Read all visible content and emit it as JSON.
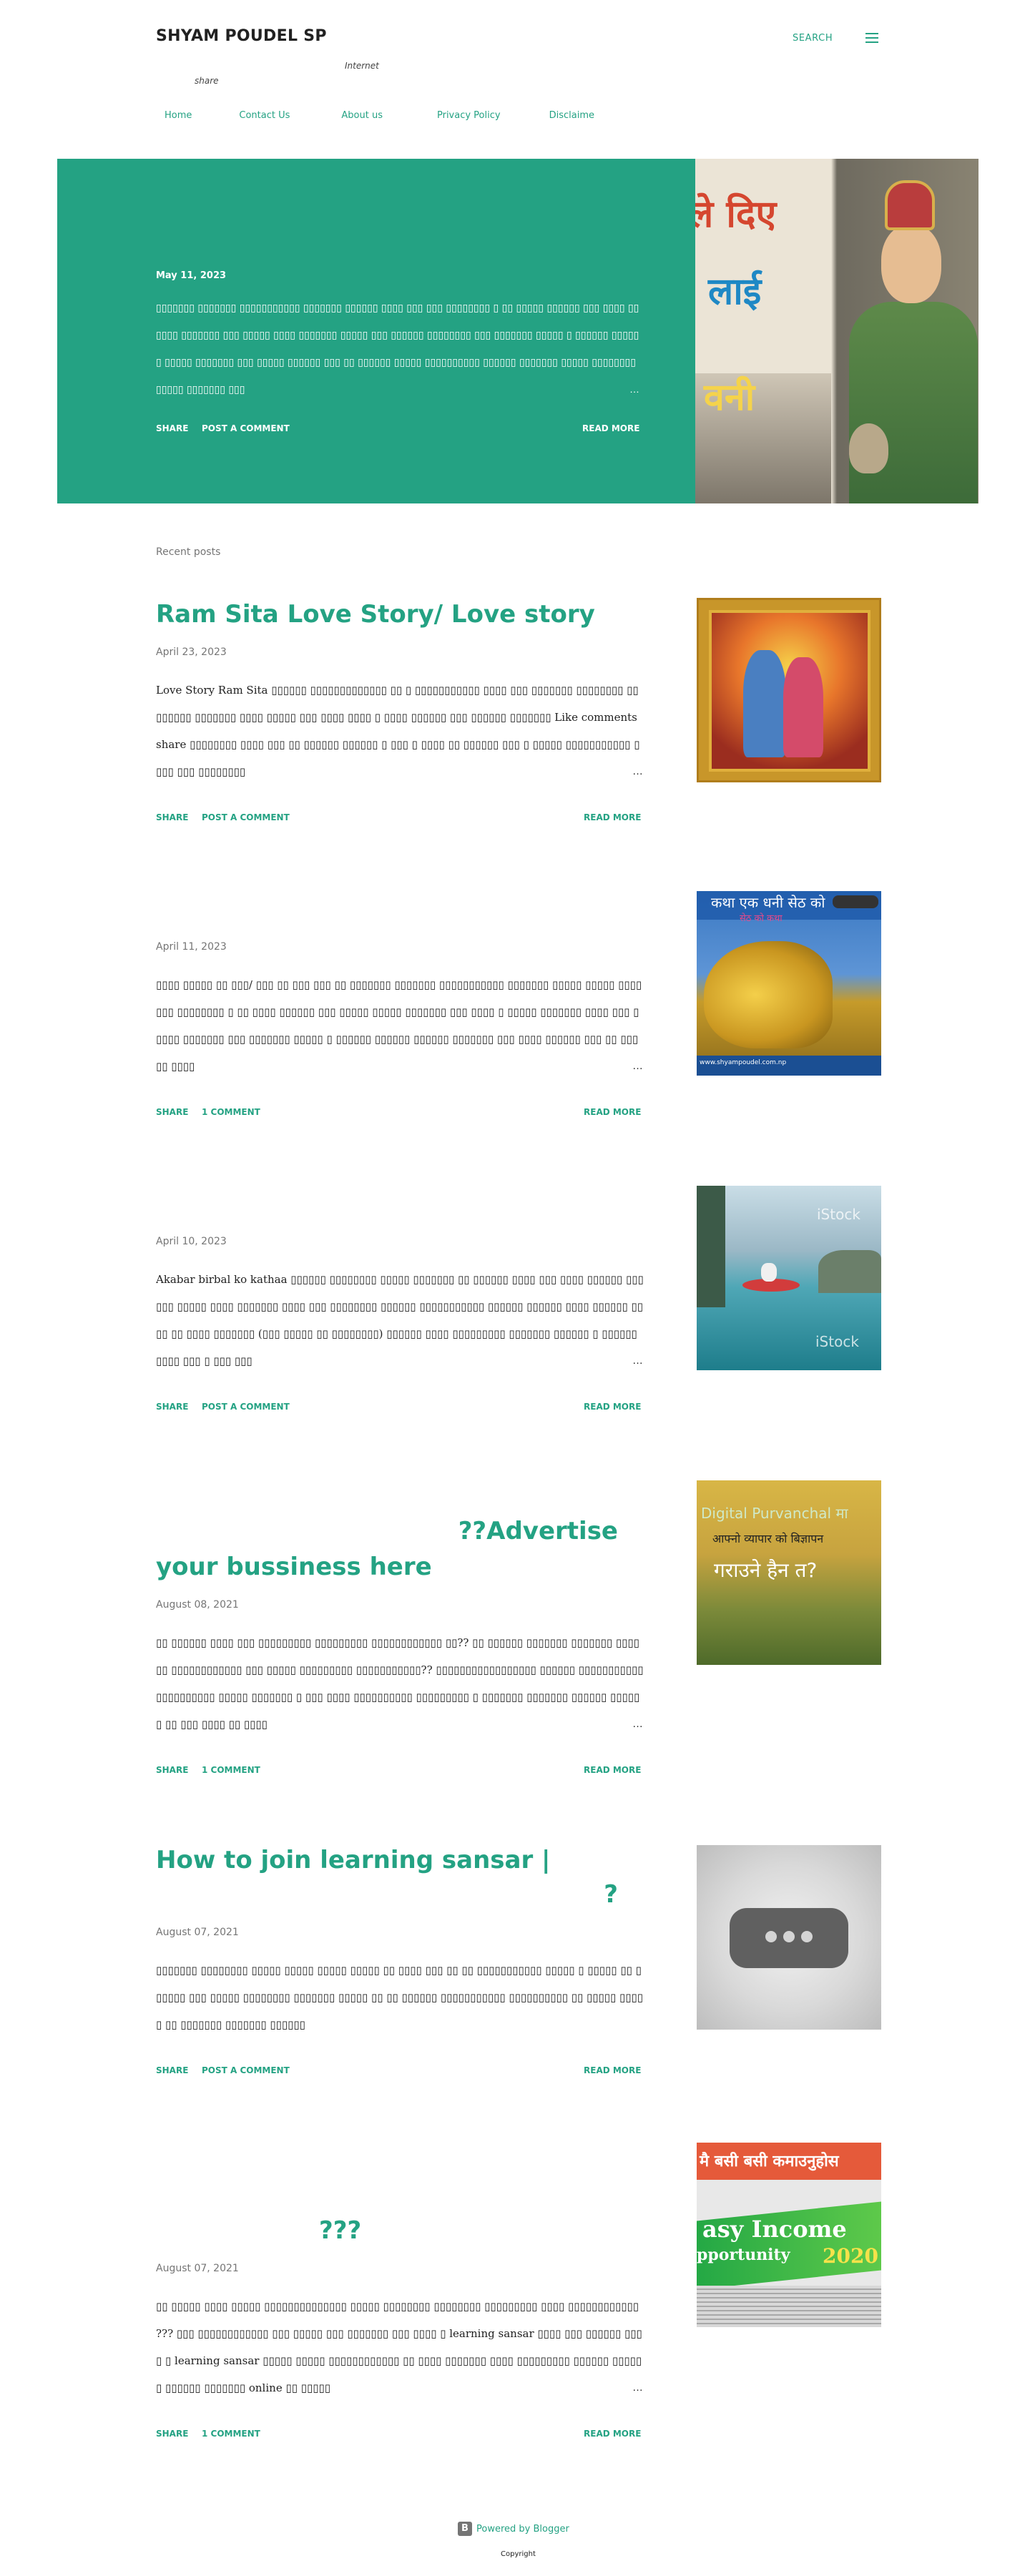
{
  "header": {
    "title": "SHYAM POUDEL SP",
    "search_label": "SEARCH",
    "tagline_1": "Internet",
    "tagline_2": "share",
    "nav": [
      "Home",
      "Contact Us",
      "About us",
      "Privacy Policy",
      "Disclaime"
    ]
  },
  "featured": {
    "date": "May 11, 2023",
    "snippet": "  ▯▯▯▯▯▯▯ ▯▯▯▯▯▯▯ ▯▯▯▯▯▯▯▯▯▯▯ ▯▯▯▯▯▯▯ ▯▯▯▯▯▯ ▯▯▯▯ ▯▯▯ ▯▯▯ ▯▯▯▯▯▯▯▯ ▯ ▯▯ ▯▯▯▯▯ ▯▯▯▯▯▯ ▯▯▯ ▯▯▯▯ ▯▯▯▯▯▯ ▯▯▯▯▯▯▯ ▯▯▯ ▯▯▯▯▯ ▯▯▯▯ ▯▯▯▯▯▯▯ ▯▯▯▯▯ ▯▯▯ ▯▯▯▯▯▯ ▯▯▯▯▯▯▯▯ ▯▯▯ ▯▯▯▯▯▯▯ ▯▯▯▯▯ ▯ ▯▯▯▯▯▯ ▯▯▯▯▯▯ ▯▯▯▯▯ ▯▯▯▯▯▯▯ ▯▯▯ ▯▯▯▯▯ ▯▯▯▯▯▯ ▯▯▯ ▯▯ ▯▯▯▯▯▯ ▯▯▯▯▯ ▯▯▯▯▯▯▯▯▯▯ ▯▯▯▯▯▯ ▯▯▯▯▯▯▯ ▯▯▯▯▯ ▯▯▯▯▯▯▯▯ ▯▯▯▯▯ ▯▯▯▯▯▯▯ ▯▯▯",
    "share_label": "SHARE",
    "comment_label": "POST A COMMENT",
    "read_more_label": "READ MORE",
    "image_text": [
      "ले दिए",
      "लाई",
      "वनी"
    ]
  },
  "recent_label": "Recent posts",
  "posts": [
    {
      "title": "Ram Sita Love Story/ Love story",
      "date": "April 23, 2023",
      "snippet": "Love Story Ram Sita ▯▯▯▯▯▯ ▯▯▯▯▯▯▯▯▯▯▯▯▯ ▯▯ ▯ ▯▯▯▯▯▯▯▯▯▯▯ ▯▯▯▯ ▯▯▯ ▯▯▯▯▯▯▯ ▯▯▯▯▯▯▯▯ ▯▯ ▯▯▯▯▯▯ ▯▯▯▯▯▯▯ ▯▯▯▯ ▯▯▯▯▯ ▯▯▯ ▯▯▯▯ ▯▯▯▯ ▯ ▯▯▯▯ ▯▯▯▯▯▯ ▯▯▯ ▯▯▯▯▯▯ ▯▯▯▯▯▯▯ Like comments share ▯▯▯▯▯▯▯▯ ▯▯▯▯ ▯▯▯ ▯▯ ▯▯▯▯▯▯ ▯▯▯▯▯▯ ▯ ▯▯▯ ▯ ▯▯▯▯ ▯▯ ▯▯▯▯▯▯   ▯▯▯ ▯ ▯▯▯▯▯ ▯▯▯▯▯▯▯▯▯▯▯ ▯▯▯▯ ▯▯▯ ▯▯▯▯▯▯▯▯",
      "share_label": "SHARE",
      "comment_label": "POST A COMMENT",
      "read_more_label": "READ MORE"
    },
    {
      "title": "",
      "date": "April 11, 2023",
      "snippet": " ▯▯▯▯ ▯▯▯▯▯ ▯▯ ▯▯▯/ ▯▯▯ ▯▯ ▯▯▯ ▯▯▯ ▯▯          ▯▯▯▯▯▯▯ ▯▯▯▯▯▯▯ ▯▯▯▯▯▯▯▯▯▯▯ ▯▯▯▯▯▯▯ ▯▯▯▯▯ ▯▯▯▯▯ ▯▯▯▯ ▯▯▯ ▯▯▯▯▯▯▯▯ ▯ ▯▯ ▯▯▯▯ ▯▯▯▯▯▯ ▯▯▯ ▯▯▯▯▯ ▯▯▯▯▯ ▯▯▯▯▯▯▯ ▯▯▯ ▯▯▯▯ ▯ ▯▯▯▯▯ ▯▯▯▯▯▯▯ ▯▯▯▯ ▯▯▯ ▯▯▯▯▯ ▯▯▯▯▯▯▯ ▯▯▯ ▯▯▯▯▯▯▯ ▯▯▯▯▯ ▯ ▯▯▯▯▯▯ ▯▯▯▯▯▯ ▯▯▯▯▯▯ ▯▯▯▯▯▯▯ ▯▯▯ ▯▯▯▯ ▯▯▯▯▯▯ ▯▯▯ ▯▯ ▯▯▯▯▯ ▯▯▯▯",
      "share_label": "SHARE",
      "comment_label": "1 COMMENT",
      "read_more_label": "READ MORE"
    },
    {
      "title": "",
      "date": "April 10, 2023",
      "snippet": "Akabar birbal ko kathaa ▯▯▯▯▯▯ ▯▯▯▯▯▯▯▯ ▯▯▯▯▯ ▯▯▯▯▯▯▯ ▯▯ ▯▯▯▯▯▯ ▯▯▯▯ ▯▯▯ ▯▯▯▯ ▯▯▯▯▯▯ ▯▯▯▯▯▯ ▯▯▯▯▯ ▯▯▯▯ ▯▯▯▯▯▯▯ ▯▯▯▯ ▯▯▯ ▯▯▯▯▯▯▯▯ ▯▯▯▯▯▯ ▯▯▯▯▯▯▯▯▯▯▯ ▯▯▯▯▯▯ ▯▯▯▯▯▯ ▯▯▯▯ ▯▯▯▯▯▯ ▯▯▯▯ ▯▯ ▯▯▯▯ ▯▯▯▯▯▯▯ (▯▯▯ ▯▯▯▯▯ ▯▯ ▯▯▯▯▯▯▯▯) ▯▯▯▯▯▯ ▯▯▯▯ ▯▯▯▯▯▯▯▯▯ ▯▯▯▯▯▯▯ ▯▯▯▯▯▯ ▯ ▯▯▯▯▯▯ ▯▯▯▯ ▯▯▯ ▯ ▯▯▯ ▯▯▯",
      "share_label": "SHARE",
      "comment_label": "POST A COMMENT",
      "read_more_label": "READ MORE"
    },
    {
      "title_line_1": "??Advertise",
      "title_line_2": "your bussiness here",
      "date": "August 08, 2021",
      "snippet": "▯▯ ▯▯▯▯▯▯ ▯▯▯▯ ▯▯▯ ▯▯▯▯▯▯▯▯▯ ▯▯▯▯▯▯▯▯▯ ▯▯▯▯▯▯▯▯▯▯▯▯ ▯▯?? ▯▯ ▯▯▯▯▯▯ ▯▯▯▯▯▯▯ ▯▯▯▯▯▯▯ ▯▯▯▯▯▯ ▯▯▯▯▯▯▯▯▯▯▯▯ ▯▯▯ ▯▯▯▯▯ ▯▯▯▯▯▯▯▯▯ ▯▯▯▯▯▯▯▯▯▯▯?? ▯▯▯▯▯▯▯▯▯▯▯▯▯▯▯▯▯ ▯▯▯▯▯▯ ▯▯▯▯▯▯▯▯▯▯▯ ▯▯▯▯▯▯▯▯▯▯ ▯▯▯▯▯ ▯▯▯▯▯▯▯ ▯ ▯▯▯ ▯▯▯▯ ▯▯▯▯▯▯▯▯▯▯ ▯▯▯▯▯▯▯▯▯ ▯ ▯▯▯▯▯▯▯ ▯▯▯▯▯▯▯ ▯▯▯▯▯▯ ▯▯▯▯▯▯ ▯▯ ▯▯▯ ▯▯▯▯ ▯▯ ▯▯▯▯",
      "share_label": "SHARE",
      "comment_label": "1 COMMENT",
      "read_more_label": "READ MORE"
    },
    {
      "title_line_1": "How to join learning sansar |",
      "title_line_2": "?",
      "date": "August 07, 2021",
      "snippet": "  ▯▯▯▯▯▯▯  ▯▯▯▯▯▯▯▯ ▯▯▯▯▯ ▯▯▯▯▯ ▯▯▯▯▯ ▯▯▯▯▯ ▯▯ ▯▯▯▯ ▯▯▯ ▯▯ ▯▯ ▯▯▯▯▯▯▯▯▯▯▯ ▯▯▯▯▯ ▯ ▯▯▯▯▯ ▯▯ ▯▯▯▯▯▯ ▯▯▯ ▯▯▯▯▯ ▯▯▯▯▯▯▯▯ ▯▯▯▯▯▯▯ ▯▯▯▯▯ ▯▯ ▯▯ ▯▯▯▯▯▯ ▯▯▯▯▯▯▯▯▯▯▯ ▯▯▯▯▯▯▯▯▯▯ ▯▯ ▯▯▯▯▯ ▯▯▯▯▯ ▯▯ ▯▯▯▯▯▯▯ ▯▯▯▯▯▯▯ ▯▯▯▯▯▯",
      "share_label": "SHARE",
      "comment_label": "POST A COMMENT",
      "read_more_label": "READ MORE"
    },
    {
      "title": "???",
      "date": "August 07, 2021",
      "snippet": "  ▯▯ ▯▯▯▯▯ ▯▯▯▯ ▯▯▯▯▯ ▯▯▯▯▯▯▯▯▯▯▯▯▯▯ ▯▯▯▯▯ ▯▯▯▯▯▯▯▯ ▯▯▯▯▯▯▯▯ ▯▯▯▯▯▯▯▯▯ ▯▯▯▯ ▯▯▯▯▯▯▯▯▯▯▯▯ ??? ▯▯▯ ▯▯▯▯▯▯▯▯▯▯▯▯ ▯▯▯ ▯▯▯▯▯ ▯▯▯ ▯▯▯▯▯▯▯ ▯▯▯ ▯▯▯▯ ▯ learning sansar  ▯▯▯▯ ▯▯▯ ▯▯▯▯▯▯ ▯▯▯▯ ▯ learning sansar ▯▯▯▯▯ ▯▯▯▯▯ ▯▯▯▯▯▯▯▯▯▯▯▯ ▯▯ ▯▯▯▯ ▯▯▯▯▯▯▯ ▯▯▯▯ ▯▯▯▯▯▯▯▯▯ ▯▯▯▯▯▯ ▯▯▯▯▯▯ ▯▯▯▯▯▯ ▯▯▯▯▯▯▯ online ▯▯ ▯▯▯▯▯",
      "share_label": "SHARE",
      "comment_label": "1 COMMENT",
      "read_more_label": "READ MORE"
    }
  ],
  "thumbnails": {
    "seth_title": "कथा एक धनी सेठ को",
    "seth_subtitle": "सेठ को कथा",
    "seth_footer": "www.shyampoudel.com.np",
    "kayak_watermark": "iStock",
    "adv_line_1": "Digital Purvanchal मा",
    "adv_line_2": "आफ्नो व्यापार को बिज्ञापन",
    "adv_line_3": "गराउने हैन त?",
    "income_top": "मै बसी बसी कमाउनुहोस",
    "income_mid_1": "asy Income",
    "income_mid_2": "pportunity",
    "income_year": "2020"
  },
  "footer": {
    "powered_by": "Powered by Blogger",
    "copyright": "Copyright"
  },
  "colors": {
    "accent": "#24a283",
    "text": "#212121",
    "muted": "#757575"
  }
}
